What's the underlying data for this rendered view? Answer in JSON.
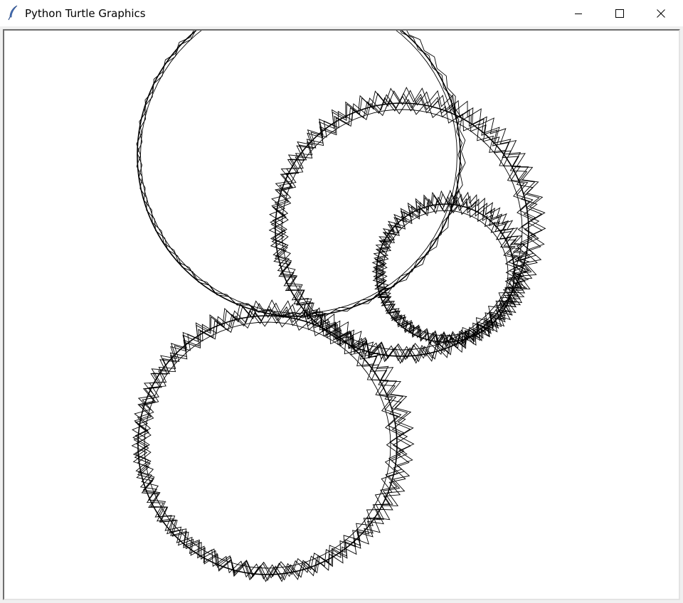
{
  "window": {
    "title": "Python Turtle Graphics",
    "icon": "feather-icon",
    "controls": {
      "minimize_icon": "minimize-icon",
      "maximize_icon": "maximize-icon",
      "close_icon": "close-icon"
    }
  },
  "canvas": {
    "background": "#ffffff",
    "pen_color": "#000000"
  }
}
